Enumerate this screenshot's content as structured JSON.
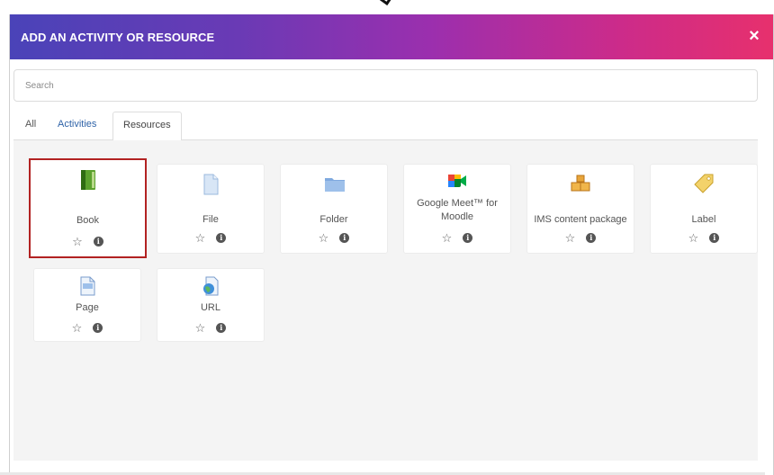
{
  "modal": {
    "title": "ADD AN ACTIVITY OR RESOURCE",
    "close_symbol": "×"
  },
  "search": {
    "placeholder": "Search"
  },
  "tabs": [
    {
      "label": "All",
      "active": false
    },
    {
      "label": "Activities",
      "active": false
    },
    {
      "label": "Resources",
      "active": true
    }
  ],
  "resources": [
    {
      "label": "Book",
      "icon": "book-icon",
      "selected": true
    },
    {
      "label": "File",
      "icon": "file-icon",
      "selected": false
    },
    {
      "label": "Folder",
      "icon": "folder-icon",
      "selected": false
    },
    {
      "label": "Google Meet™ for Moodle",
      "icon": "google-meet-icon",
      "selected": false
    },
    {
      "label": "IMS content package",
      "icon": "ims-package-icon",
      "selected": false
    },
    {
      "label": "Label",
      "icon": "label-tag-icon",
      "selected": false
    },
    {
      "label": "Page",
      "icon": "page-icon",
      "selected": false
    },
    {
      "label": "URL",
      "icon": "url-globe-icon",
      "selected": false
    }
  ],
  "card_actions": {
    "star_symbol": "☆",
    "info_symbol": "i"
  },
  "colors": {
    "header_gradient_start": "#4a43b8",
    "header_gradient_end": "#e7306d",
    "selection_border": "#b22222",
    "link_blue": "#2f63a8"
  }
}
